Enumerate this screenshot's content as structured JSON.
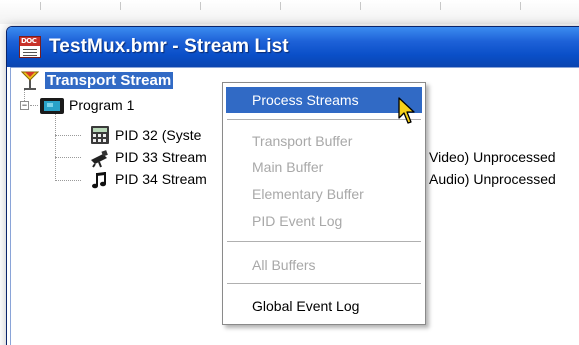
{
  "window": {
    "title": "TestMux.bmr - Stream List",
    "title_icon": "doc-icon",
    "title_icon_text": "DOC"
  },
  "tree": {
    "root": {
      "label": "Transport Stream",
      "icon": "transport-stream-icon",
      "selected": true
    },
    "program": {
      "label": "Program 1",
      "icon": "program-tv-icon",
      "expander": "−"
    },
    "pids": [
      {
        "label": "PID 32 (Syste",
        "icon": "calculator-icon"
      },
      {
        "label": "PID 33 Stream",
        "icon": "camera-icon",
        "trailing": "Video) Unprocessed"
      },
      {
        "label": "PID 34 Stream",
        "icon": "music-note-icon",
        "trailing": "Audio) Unprocessed"
      }
    ],
    "root_expander": "−"
  },
  "context_menu": {
    "items": [
      {
        "label": "Process Streams",
        "enabled": true,
        "selected": true
      },
      {
        "label": "Transport Buffer",
        "enabled": false
      },
      {
        "label": "Main Buffer",
        "enabled": false
      },
      {
        "label": "Elementary Buffer",
        "enabled": false
      },
      {
        "label": "PID Event Log",
        "enabled": false
      },
      {
        "label": "All Buffers",
        "enabled": false
      },
      {
        "label": "Global Event Log",
        "enabled": true
      }
    ]
  },
  "colors": {
    "selection": "#316ac5",
    "titlebar": "#0a4fc8",
    "disabled_text": "#a8a8a8"
  }
}
